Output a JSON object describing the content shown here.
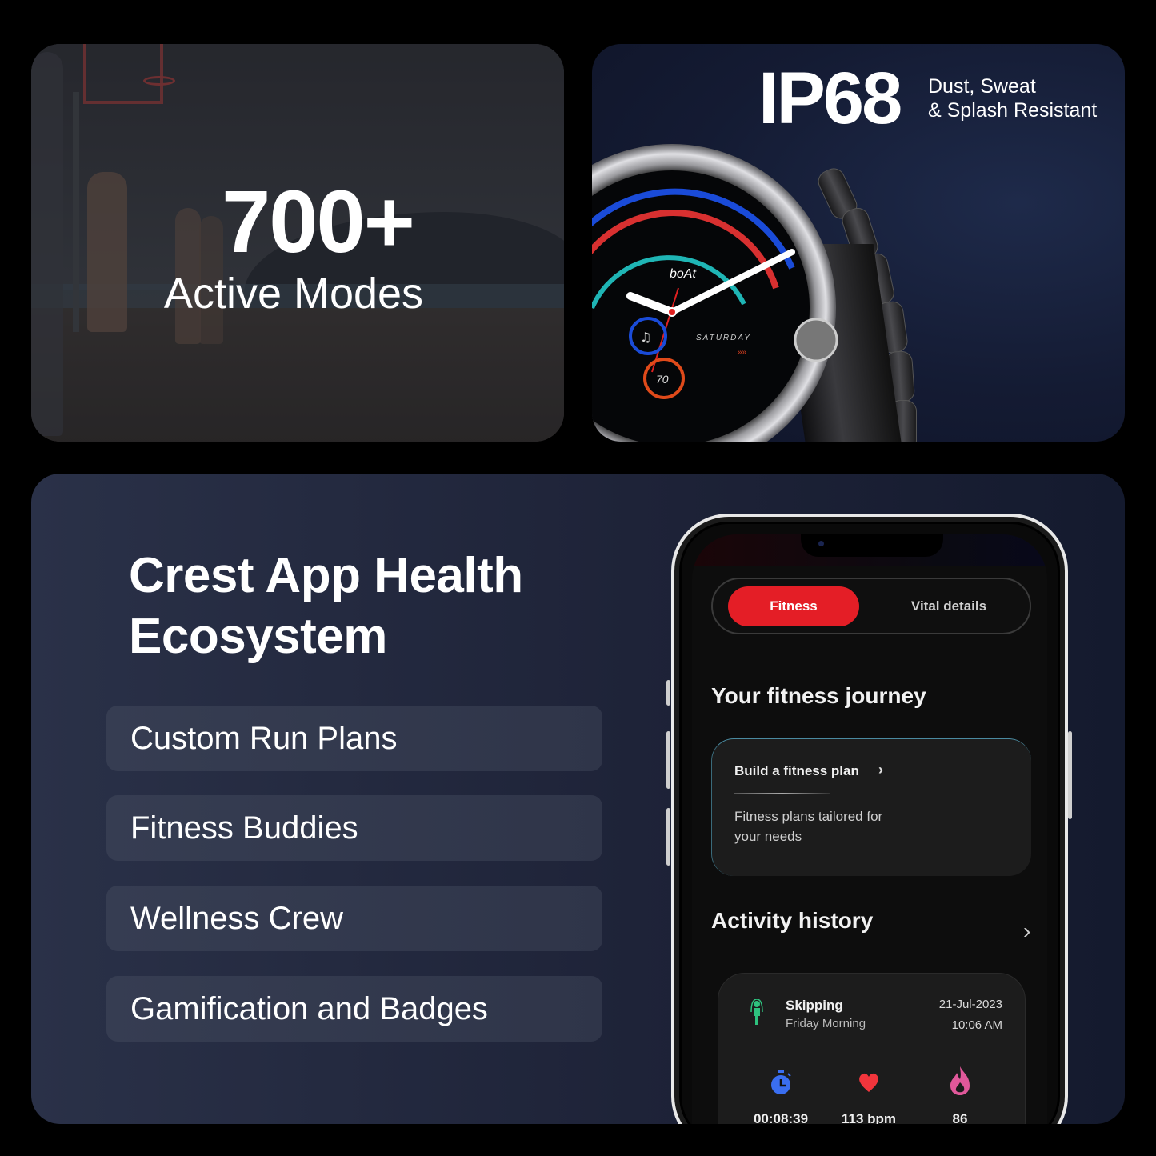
{
  "modes_card": {
    "headline": "700+",
    "subheadline": "Active Modes"
  },
  "ip_card": {
    "headline": "IP68",
    "line1": "Dust, Sweat",
    "line2": "& Splash Resistant",
    "watch": {
      "brand": "boAt",
      "day": "SATURDAY",
      "complication_value": "70"
    }
  },
  "app_card": {
    "title_line1": "Crest App Health",
    "title_line2": "Ecosystem",
    "features": [
      "Custom Run Plans",
      "Fitness Buddies",
      "Wellness Crew",
      "Gamification and Badges"
    ],
    "phone": {
      "tabs": [
        {
          "label": "Fitness",
          "active": true
        },
        {
          "label": "Vital details",
          "active": false
        }
      ],
      "journey_title": "Your fitness journey",
      "plan_card": {
        "title": "Build a fitness plan",
        "description": "Fitness plans tailored for your needs"
      },
      "activity_title": "Activity history",
      "activity": {
        "name": "Skipping",
        "period": "Friday Morning",
        "date": "21-Jul-2023",
        "time": "10:06 AM",
        "stats": [
          {
            "icon": "stopwatch-icon",
            "value": "00:08:39"
          },
          {
            "icon": "heart-icon",
            "value": "113 bpm"
          },
          {
            "icon": "flame-icon",
            "value": "86"
          }
        ]
      }
    }
  },
  "colors": {
    "accent_red": "#e41e26",
    "card_navy": "#1e2338",
    "feature_pill": "#363d52"
  }
}
